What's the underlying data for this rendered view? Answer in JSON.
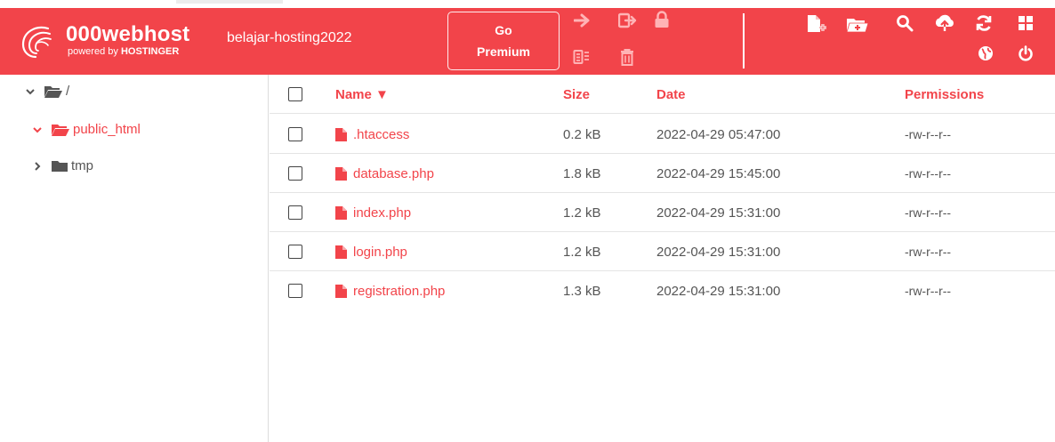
{
  "brand": {
    "name": "000webhost",
    "sub_prefix": "powered by ",
    "sub_brand": "HOSTINGER"
  },
  "header": {
    "site_name": "belajar-hosting2022",
    "go_premium": {
      "line1": "Go",
      "line2": "Premium"
    },
    "colors": {
      "accent": "#f2444a",
      "header_text": "#ffffff"
    },
    "toolbar_left_icons": [
      "move-arrow-icon",
      "rename-export-icon",
      "lock-icon",
      "archive-icon",
      "trash-icon"
    ],
    "toolbar_right_icons": [
      "new-file-icon",
      "new-folder-icon",
      "search-icon",
      "upload-icon",
      "refresh-icon",
      "grid-view-icon",
      "globe-icon",
      "power-icon"
    ]
  },
  "sidebar": {
    "root": {
      "label": "/"
    },
    "items": [
      {
        "label": "public_html",
        "expanded": true,
        "selected": true
      },
      {
        "label": "tmp",
        "expanded": false,
        "selected": false
      }
    ]
  },
  "table": {
    "headers": {
      "name": "Name ▼",
      "size": "Size",
      "date": "Date",
      "permissions": "Permissions"
    },
    "rows": [
      {
        "name": ".htaccess",
        "size": "0.2 kB",
        "date": "2022-04-29 05:47:00",
        "perm": "-rw-r--r--"
      },
      {
        "name": "database.php",
        "size": "1.8 kB",
        "date": "2022-04-29 15:45:00",
        "perm": "-rw-r--r--"
      },
      {
        "name": "index.php",
        "size": "1.2 kB",
        "date": "2022-04-29 15:31:00",
        "perm": "-rw-r--r--"
      },
      {
        "name": "login.php",
        "size": "1.2 kB",
        "date": "2022-04-29 15:31:00",
        "perm": "-rw-r--r--"
      },
      {
        "name": "registration.php",
        "size": "1.3 kB",
        "date": "2022-04-29 15:31:00",
        "perm": "-rw-r--r--"
      }
    ]
  }
}
